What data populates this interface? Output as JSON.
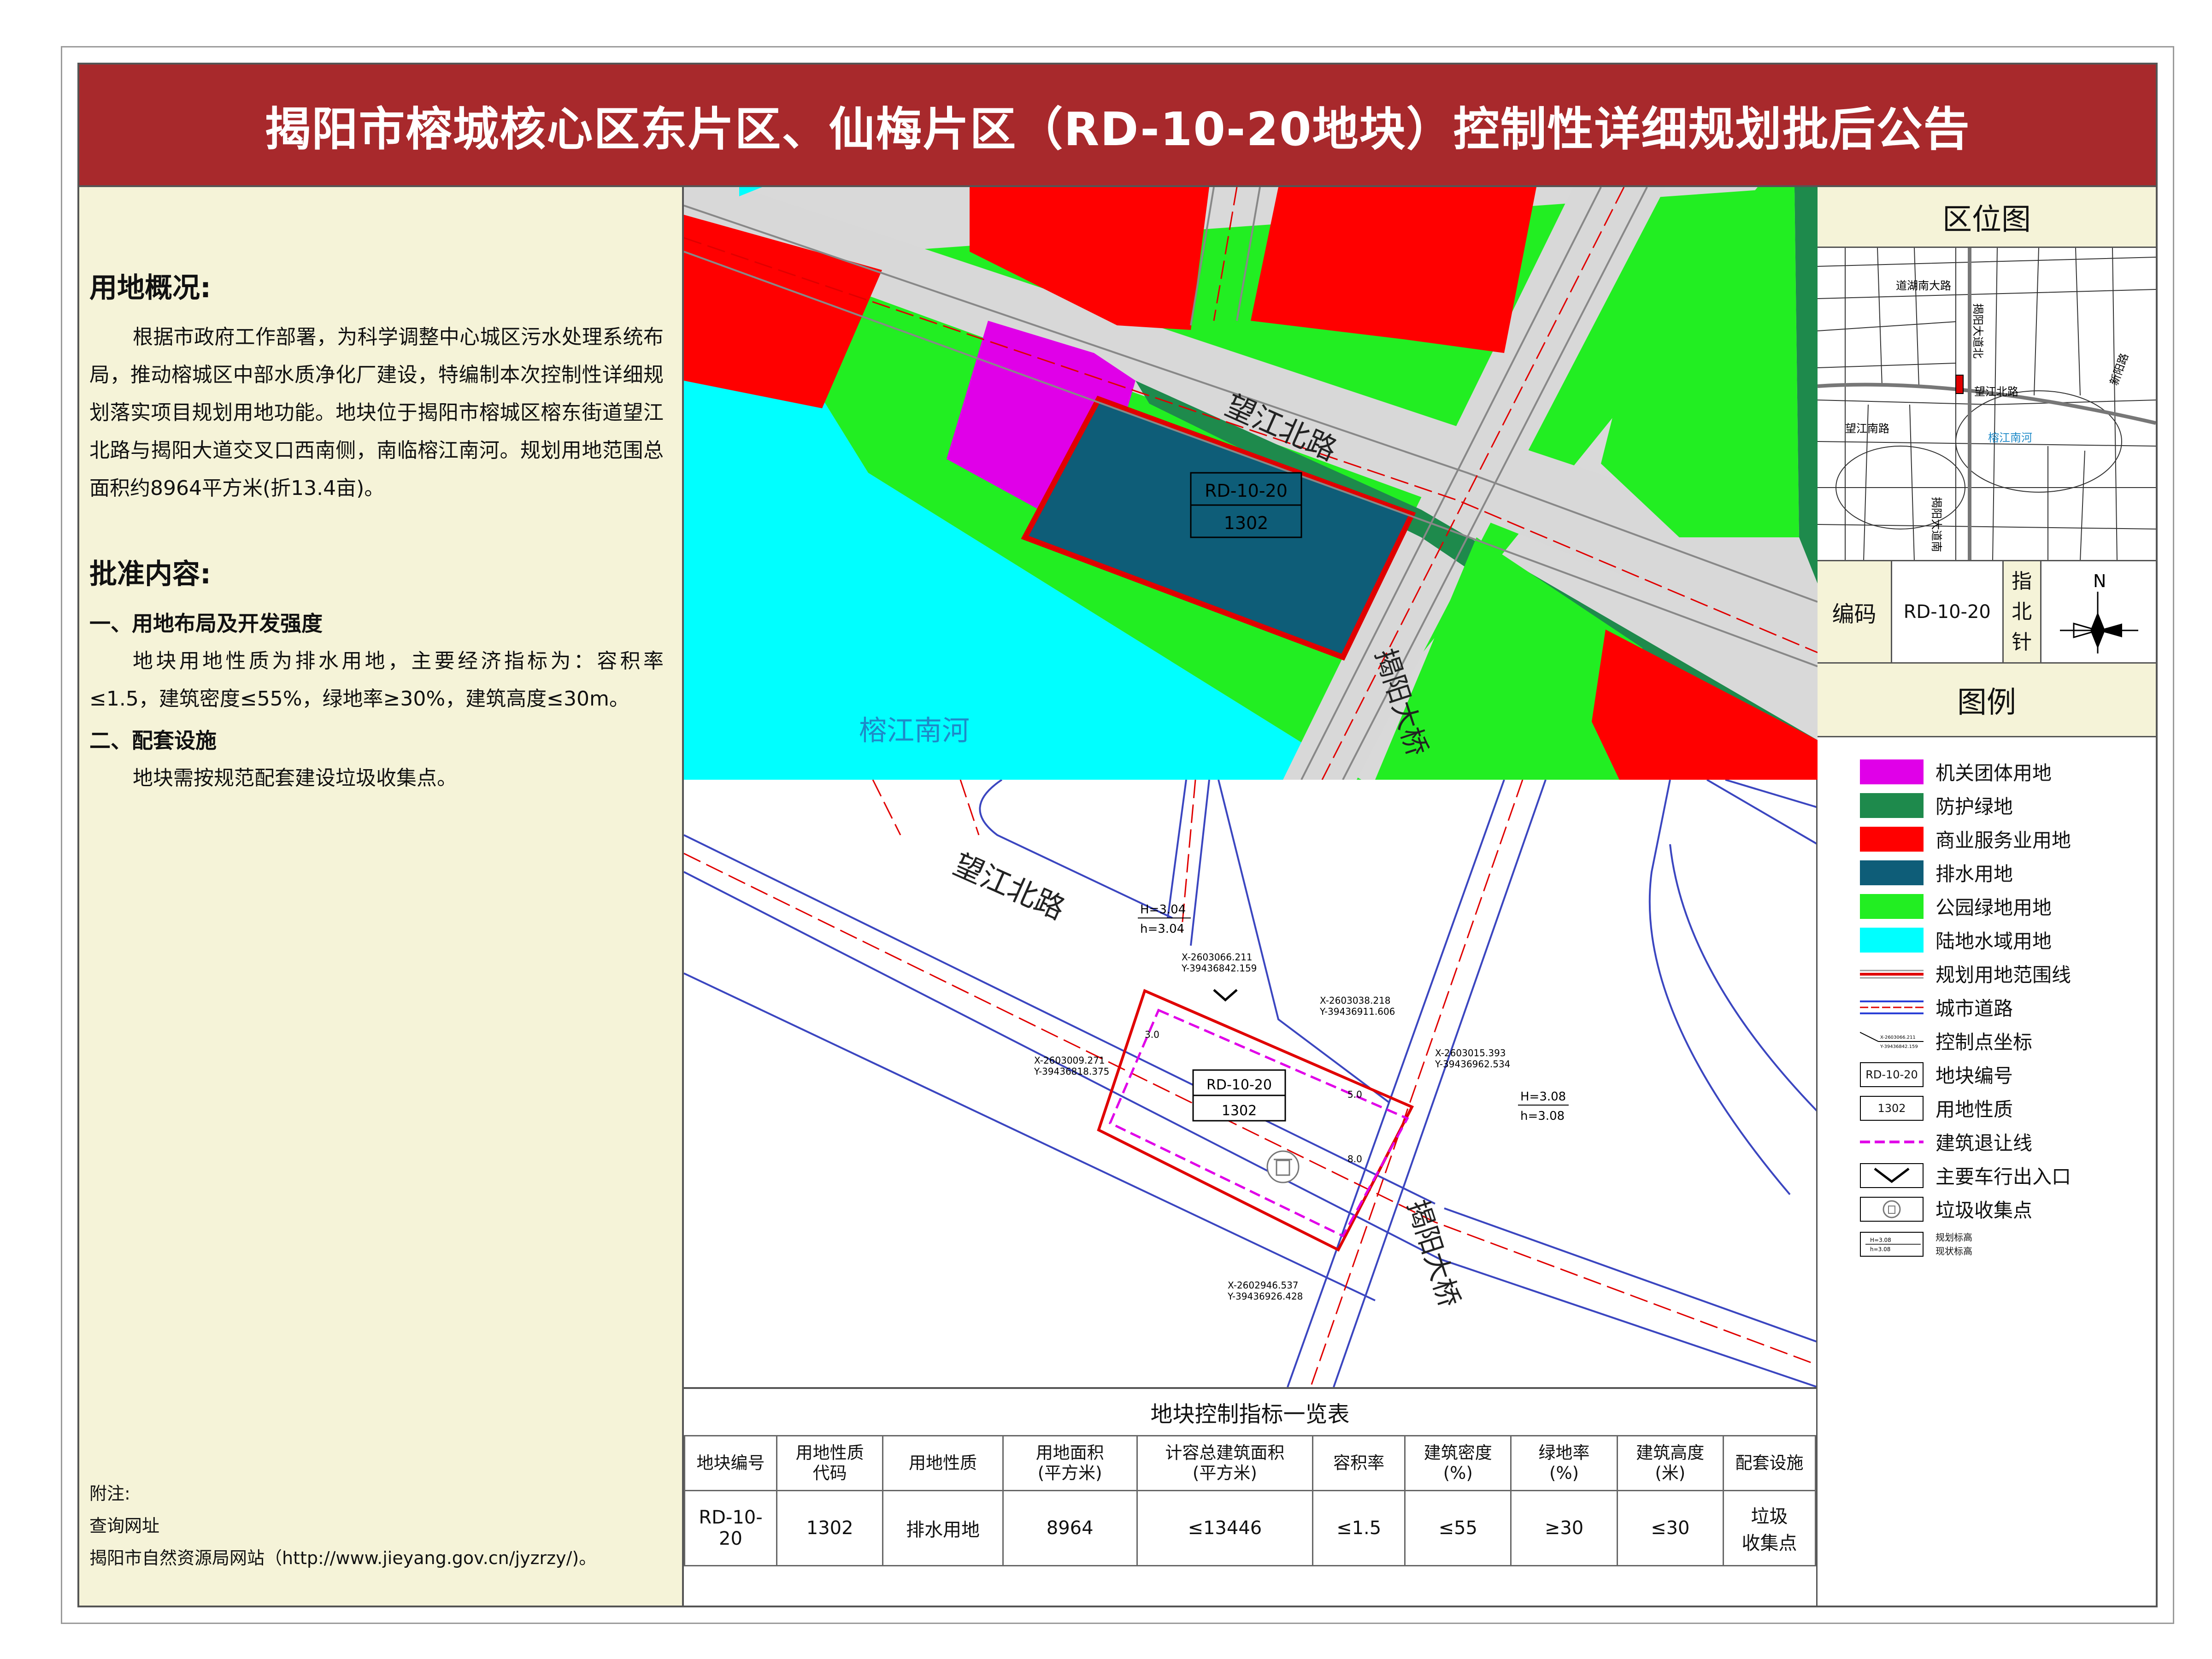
{
  "title": "揭阳市榕城核心区东片区、仙梅片区（RD-10-20地块）控制性详细规划批后公告",
  "overview": {
    "heading": "用地概况:",
    "text": "根据市政府工作部署，为科学调整中心城区污水处理系统布局，推动榕城区中部水质净化厂建设，特编制本次控制性详细规划落实项目规划用地功能。地块位于揭阳市榕城区榕东街道望江北路与揭阳大道交叉口西南侧，南临榕江南河。规划用地范围总面积约8964平方米(折13.4亩)。"
  },
  "approval": {
    "heading": "批准内容:",
    "sec1_title": "一、用地布局及开发强度",
    "sec1_text": "地块用地性质为排水用地，主要经济指标为：容积率≤1.5，建筑密度≤55%，绿地率≥30%，建筑高度≤30m。",
    "sec2_title": "二、配套设施",
    "sec2_text": "地块需按规范配套建设垃圾收集点。"
  },
  "notes": {
    "label": "附注:",
    "line1": "查询网址",
    "line2": "揭阳市自然资源局网站（http://www.jieyang.gov.cn/jyzrzy/)。"
  },
  "map_top": {
    "road_wangjiang": "望江北路",
    "road_jieyang_bridge": "揭阳大桥",
    "river": "榕江南河",
    "parcel_code": "RD-10-20",
    "parcel_use": "1302"
  },
  "map_bottom": {
    "road_wangjiang": "望江北路",
    "road_jieyang_bridge": "揭阳大桥",
    "parcel_code": "RD-10-20",
    "parcel_use": "1302",
    "elev1_H": "H=3.04",
    "elev1_h": "h=3.04",
    "elev2_H": "H=3.08",
    "elev2_h": "h=3.08",
    "coord1_x": "X-2603066.211",
    "coord1_y": "Y-39436842.159",
    "coord2_x": "X-2603038.218",
    "coord2_y": "Y-39436911.606",
    "coord3_x": "X-2603009.271",
    "coord3_y": "Y-39436818.375",
    "coord4_x": "X-2603015.393",
    "coord4_y": "Y-39436962.534",
    "coord5_x": "X-2602946.537",
    "coord5_y": "Y-39436926.428",
    "setback_a": "3.0",
    "setback_b": "5.0",
    "setback_c": "8.0"
  },
  "table": {
    "title": "地块控制指标一览表",
    "headers": [
      [
        "地块编号"
      ],
      [
        "用地性质",
        "代码"
      ],
      [
        "用地性质"
      ],
      [
        "用地面积",
        "(平方米)"
      ],
      [
        "计容总建筑面积",
        "(平方米)"
      ],
      [
        "容积率"
      ],
      [
        "建筑密度",
        "(%)"
      ],
      [
        "绿地率",
        "(%)"
      ],
      [
        "建筑高度",
        "(米)"
      ],
      [
        "配套设施"
      ]
    ],
    "row": [
      "RD-10-20",
      "1302",
      "排水用地",
      "8964",
      "≤13446",
      "≤1.5",
      "≤55",
      "≥30",
      "≤30",
      "垃圾\n收集点"
    ]
  },
  "location_map": {
    "heading": "区位图",
    "labels": [
      "道湖南大路",
      "揭阳大道北",
      "望江北路",
      "望江南路",
      "榕江南河",
      "揭阳大道南",
      "新阳路"
    ]
  },
  "code_box": {
    "label": "编码",
    "value": "RD-10-20",
    "north_label": [
      "指",
      "北",
      "针"
    ],
    "north_letter": "N"
  },
  "legend": {
    "heading": "图例",
    "items": [
      {
        "label": "机关团体用地",
        "color": "#e000e8"
      },
      {
        "label": "防护绿地",
        "color": "#1e8a4c"
      },
      {
        "label": "商业服务业用地",
        "color": "#ff0000"
      },
      {
        "label": "排水用地",
        "color": "#0e5d78"
      },
      {
        "label": "公园绿地用地",
        "color": "#22ee22"
      },
      {
        "label": "陆地水域用地",
        "color": "#00ffff"
      },
      {
        "label": "规划用地范围线",
        "color": "#e00000"
      },
      {
        "label": "城市道路",
        "color": "#2b3fd6"
      },
      {
        "label": "控制点坐标",
        "color": "#333333"
      },
      {
        "label": "地块编号",
        "color": "#000000"
      },
      {
        "label": "用地性质",
        "color": "#000000"
      },
      {
        "label": "建筑退让线",
        "color": "#e000e8"
      },
      {
        "label": "主要车行出入口",
        "color": "#000000"
      },
      {
        "label": "垃圾收集点",
        "color": "#666666"
      }
    ],
    "elev_sample_H": "H=3.08",
    "elev_sample_h": "h=3.08",
    "elev_planned": "规划标高",
    "elev_existing": "现状标高",
    "coord_sample_x": "X-2603066.211",
    "coord_sample_y": "Y-39436842.159",
    "code_sample": "RD-10-20",
    "use_sample": "1302"
  }
}
